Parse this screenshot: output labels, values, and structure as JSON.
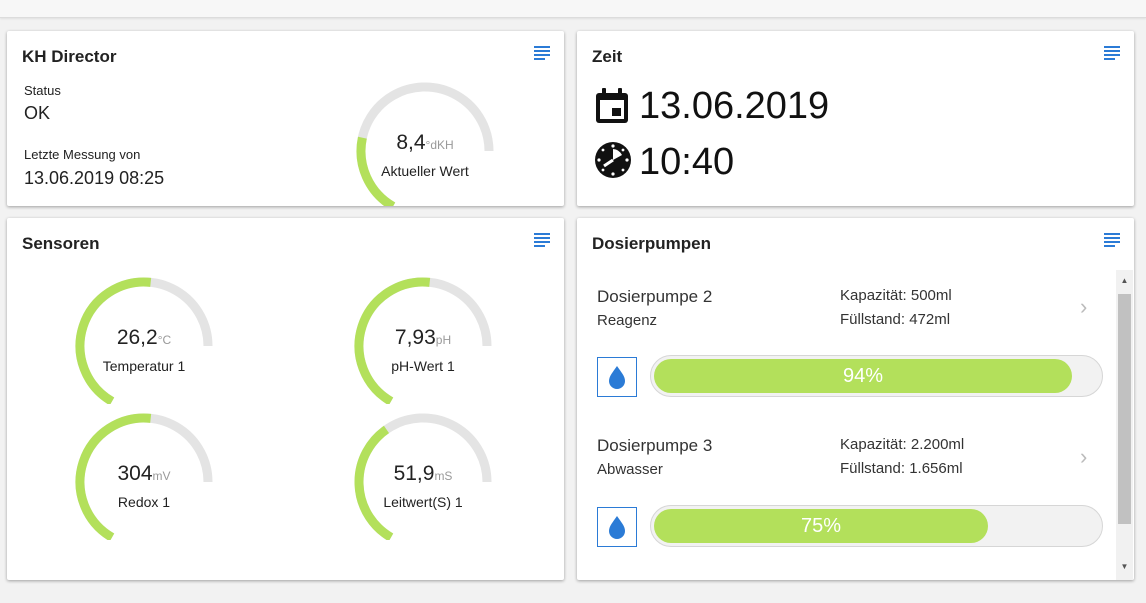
{
  "colors": {
    "accent": "#b3e05b",
    "track": "#e4e4e4",
    "menu_icon": "#2b7bd6"
  },
  "kh": {
    "title": "KH Director",
    "status_label": "Status",
    "status_value": "OK",
    "last_label": "Letzte Messung von",
    "last_value": "13.06.2019 08:25",
    "gauge": {
      "value": "8,4",
      "unit": "°dKH",
      "caption": "Aktueller Wert",
      "fraction": 0.3
    }
  },
  "zeit": {
    "title": "Zeit",
    "date": "13.06.2019",
    "time": "10:40",
    "date_icon": "calendar-icon",
    "time_icon": "clock-icon"
  },
  "sensoren": {
    "title": "Sensoren",
    "gauges": [
      {
        "value": "26,2",
        "unit": "°C",
        "caption": "Temperatur 1",
        "fraction": 0.65
      },
      {
        "value": "7,93",
        "unit": "pH",
        "caption": "pH-Wert 1",
        "fraction": 0.65
      },
      {
        "value": "304",
        "unit": "mV",
        "caption": "Redox 1",
        "fraction": 0.65
      },
      {
        "value": "51,9",
        "unit": "mS",
        "caption": "Leitwert(S) 1",
        "fraction": 0.48
      }
    ]
  },
  "dosier": {
    "title": "Dosierpumpen",
    "pumps": [
      {
        "name": "Dosierpumpe 2",
        "sub": "Reagenz",
        "capacity": "Kapazität: 500ml",
        "level": "Füllstand: 472ml",
        "percent_label": "94%",
        "fill": 0.94
      },
      {
        "name": "Dosierpumpe 3",
        "sub": "Abwasser",
        "capacity": "Kapazität: 2.200ml",
        "level": "Füllstand: 1.656ml",
        "percent_label": "75%",
        "fill": 0.75
      }
    ]
  }
}
